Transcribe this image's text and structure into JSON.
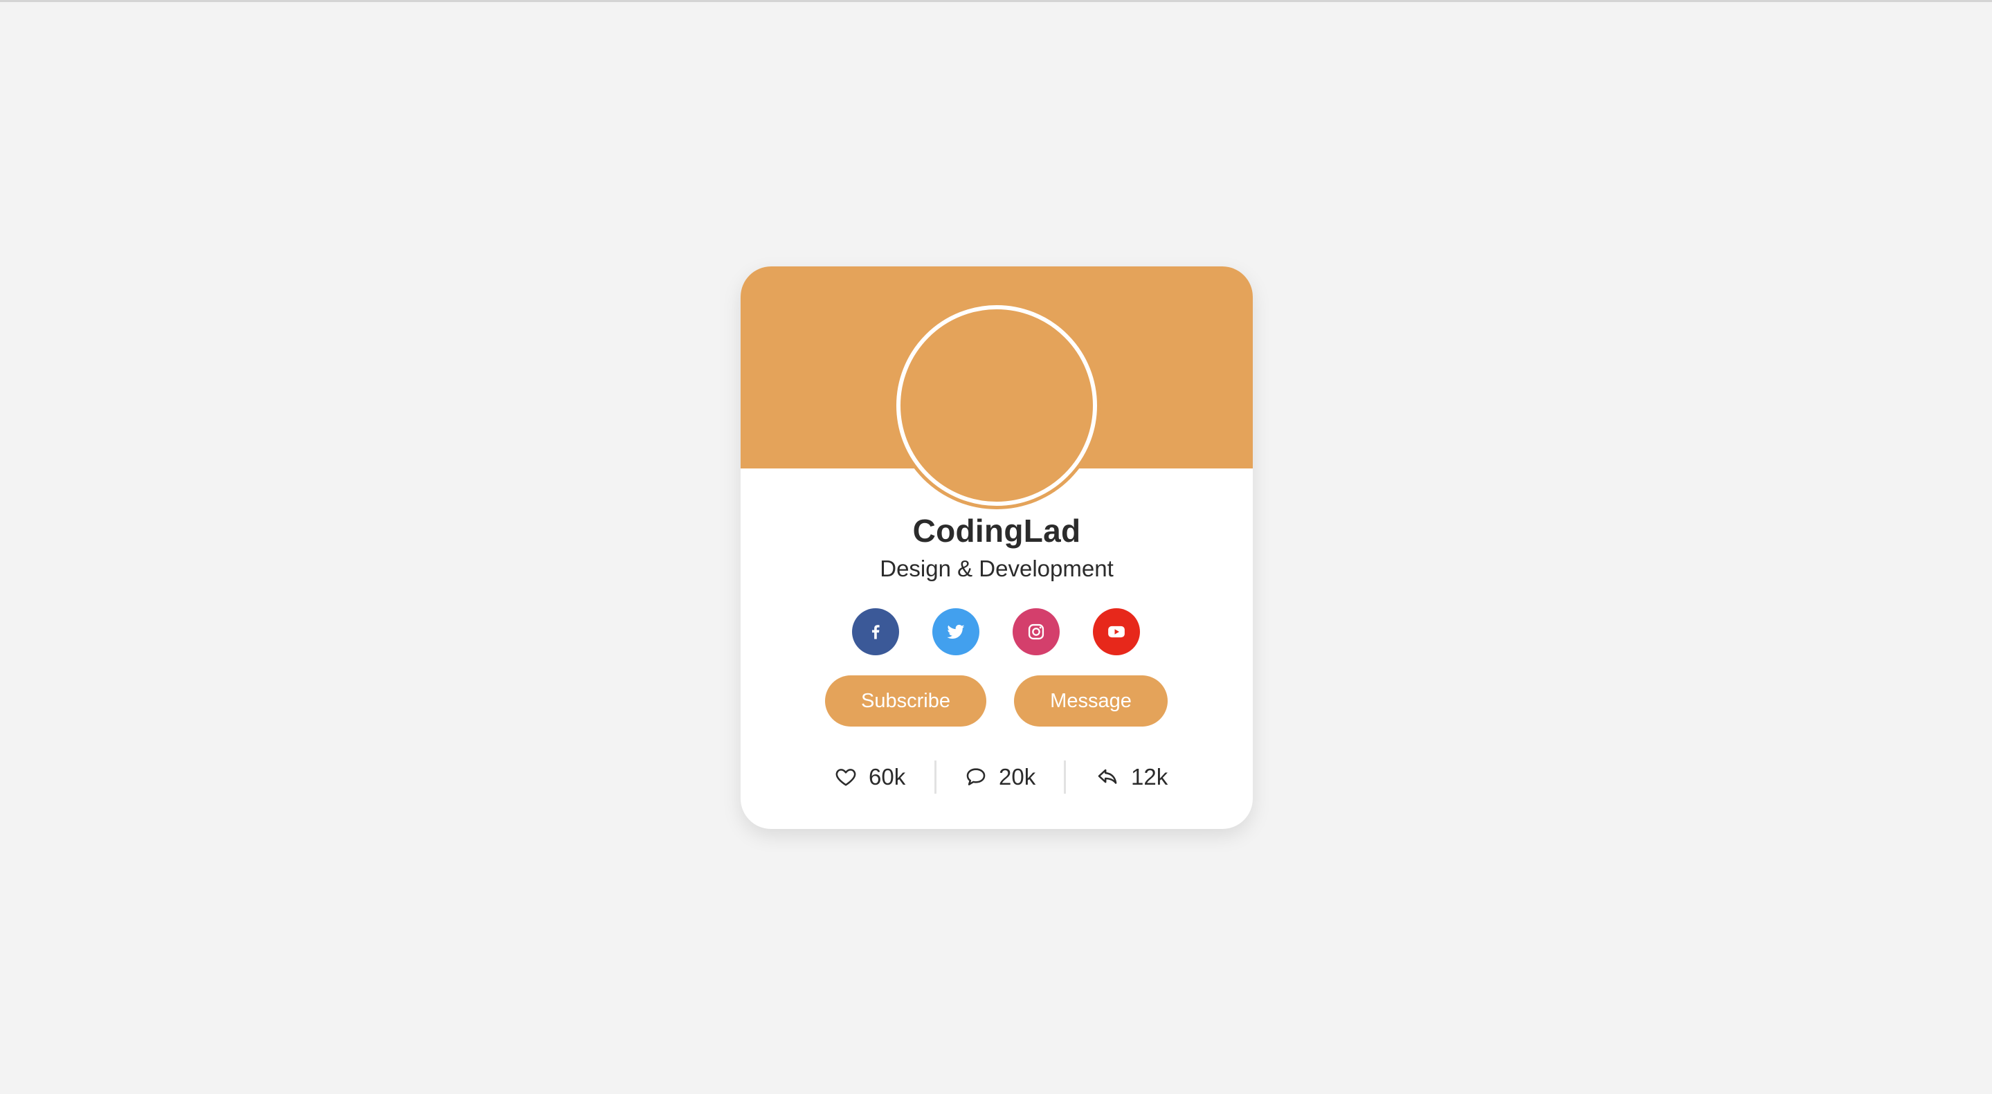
{
  "profile": {
    "name": "CodingLad",
    "role": "Design & Development"
  },
  "social": [
    {
      "name": "facebook",
      "icon": "facebook-icon",
      "color": "#3b5998"
    },
    {
      "name": "twitter",
      "icon": "twitter-icon",
      "color": "#42a0ee"
    },
    {
      "name": "instagram",
      "icon": "instagram-icon",
      "color": "#d43f6c"
    },
    {
      "name": "youtube",
      "icon": "youtube-icon",
      "color": "#e7281b"
    }
  ],
  "buttons": {
    "subscribe_label": "Subscribe",
    "message_label": "Message"
  },
  "stats": {
    "likes": "60k",
    "comments": "20k",
    "shares": "12k"
  },
  "colors": {
    "accent": "#e4a35a",
    "background": "#f3f3f3",
    "card": "#ffffff"
  }
}
